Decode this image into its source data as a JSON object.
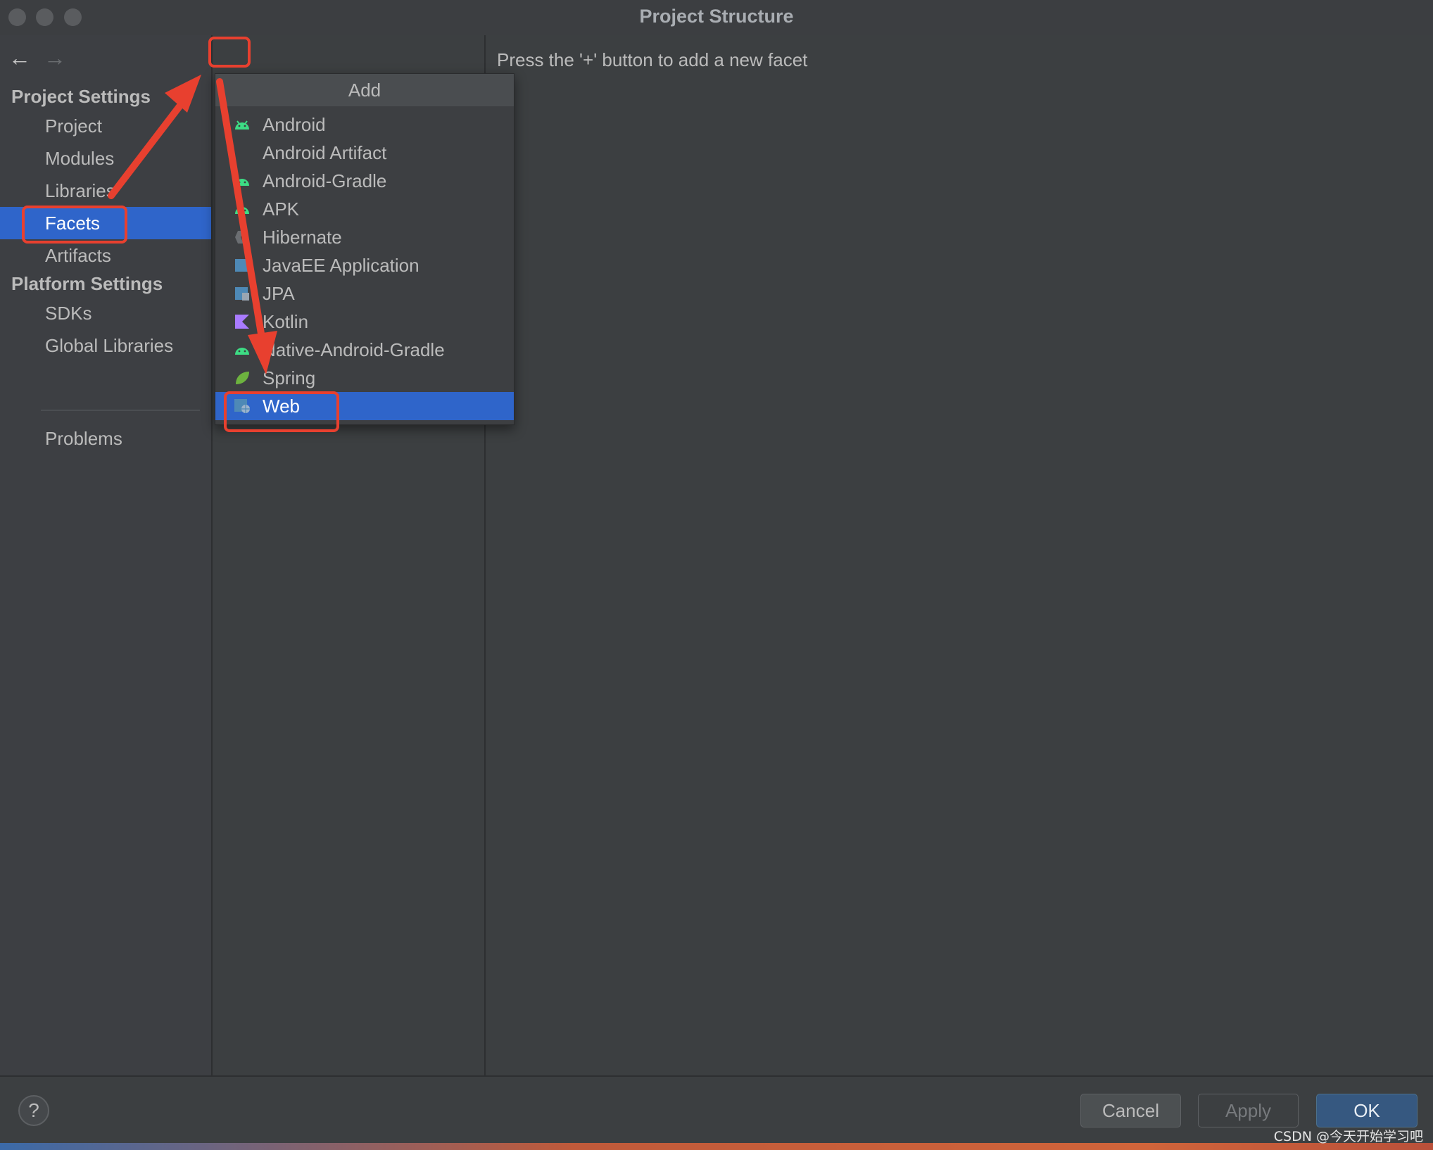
{
  "window": {
    "title": "Project Structure"
  },
  "nav": {
    "back_icon": "←",
    "forward_icon": "→"
  },
  "sidebar": {
    "project_settings_heading": "Project Settings",
    "platform_settings_heading": "Platform Settings",
    "items": [
      {
        "label": "Project"
      },
      {
        "label": "Modules"
      },
      {
        "label": "Libraries"
      },
      {
        "label": "Facets",
        "selected": true
      },
      {
        "label": "Artifacts"
      },
      {
        "label": "SDKs"
      },
      {
        "label": "Global Libraries"
      },
      {
        "label": "Problems"
      }
    ]
  },
  "toolbar": {
    "add_label": "+",
    "remove_label": "−"
  },
  "detail": {
    "hint": "Press the '+' button to add a new facet"
  },
  "popup": {
    "header": "Add",
    "items": [
      {
        "label": "Android",
        "icon": "android-icon"
      },
      {
        "label": "Android Artifact",
        "icon": "none"
      },
      {
        "label": "Android-Gradle",
        "icon": "android-icon"
      },
      {
        "label": "APK",
        "icon": "android-icon"
      },
      {
        "label": "Hibernate",
        "icon": "hibernate-icon"
      },
      {
        "label": "JavaEE Application",
        "icon": "javaee-icon"
      },
      {
        "label": "JPA",
        "icon": "jpa-icon"
      },
      {
        "label": "Kotlin",
        "icon": "kotlin-icon"
      },
      {
        "label": "Native-Android-Gradle",
        "icon": "android-icon"
      },
      {
        "label": "Spring",
        "icon": "spring-icon"
      },
      {
        "label": "Web",
        "icon": "web-icon",
        "selected": true
      }
    ]
  },
  "footer": {
    "help_label": "?",
    "cancel_label": "Cancel",
    "apply_label": "Apply",
    "ok_label": "OK"
  },
  "watermark": "CSDN @今天开始学习吧",
  "colors": {
    "selection": "#2f65ca",
    "annotation_red": "#e8402f",
    "android_green": "#3ddc84",
    "kotlin_purple": "#a97bff",
    "spring_green": "#6db33f"
  }
}
